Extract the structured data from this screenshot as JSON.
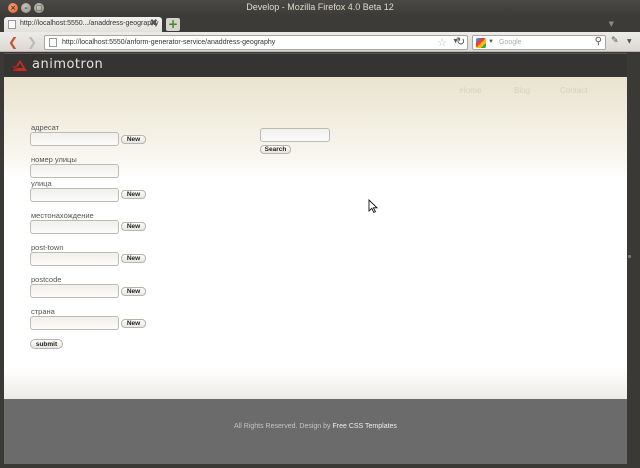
{
  "window": {
    "title": "Develop - Mozilla Firefox 4.0 Beta 12",
    "close_glyph": "×",
    "min_glyph": "–",
    "max_glyph": "□"
  },
  "tab": {
    "title": "http://localhost:5550.../anaddress-geography",
    "close_glyph": "✖",
    "new_tab_glyph": "+",
    "list_glyph": "▼"
  },
  "nav": {
    "back_glyph": "❮",
    "forward_glyph": "❯",
    "url": "http://localhost:5550/anform-generator-service/anaddress-geography",
    "star_glyph": "☆",
    "dropdown_glyph": "▼",
    "reload_glyph": "↻",
    "search_placeholder": "Google",
    "search_glyph": "⚲",
    "addon_glyph": "✎",
    "addon_menu_glyph": "▼"
  },
  "site": {
    "logo_text": "animotron",
    "nav": [
      "Home",
      "Blog",
      "Contact"
    ]
  },
  "form": {
    "fields": [
      {
        "label": "адресат",
        "has_new": true
      },
      {
        "label": "номер улицы",
        "has_new": false
      },
      {
        "label": "улица",
        "has_new": true
      },
      {
        "label": "местонахождение",
        "has_new": true
      },
      {
        "label": "post-town",
        "has_new": true
      },
      {
        "label": "postcode",
        "has_new": true
      },
      {
        "label": "страна",
        "has_new": true
      }
    ],
    "new_label": "New",
    "submit_label": "submit"
  },
  "search": {
    "button_label": "Search"
  },
  "footer": {
    "text": "All Rights Reserved. Design by ",
    "link": "Free CSS Templates"
  },
  "colors": {
    "chrome_dark": "#3c3b37",
    "site_header": "#353433",
    "hero_top": "#e9e3cf",
    "footer": "#6b6b6b",
    "logo_red": "#c62d1f"
  }
}
